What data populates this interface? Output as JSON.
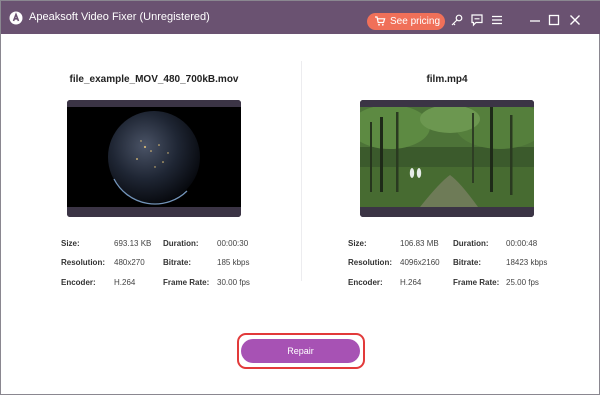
{
  "window": {
    "title": "Apeaksoft Video Fixer (Unregistered)",
    "pricing_label": "See pricing",
    "icons": [
      "key-icon",
      "feedback-icon",
      "menu-icon",
      "minimize-icon",
      "maximize-icon",
      "close-icon"
    ]
  },
  "colors": {
    "titlebar": "#6a5271",
    "pricing_button": "#f07059",
    "repair_button": "#a752b4",
    "highlight_outline": "#e23a3a"
  },
  "left_video": {
    "file_name": "file_example_MOV_480_700kB.mov",
    "thumbnail": "earth-at-night",
    "labels": {
      "size": "Size:",
      "duration": "Duration:",
      "resolution": "Resolution:",
      "bitrate": "Bitrate:",
      "encoder": "Encoder:",
      "frame_rate": "Frame Rate:"
    },
    "size": "693.13 KB",
    "duration": "00:00:30",
    "resolution": "480x270",
    "bitrate": "185 kbps",
    "encoder": "H.264",
    "frame_rate": "30.00 fps"
  },
  "right_video": {
    "file_name": "film.mp4",
    "thumbnail": "forest-path",
    "labels": {
      "size": "Size:",
      "duration": "Duration:",
      "resolution": "Resolution:",
      "bitrate": "Bitrate:",
      "encoder": "Encoder:",
      "frame_rate": "Frame Rate:"
    },
    "size": "106.83 MB",
    "duration": "00:00:48",
    "resolution": "4096x2160",
    "bitrate": "18423 kbps",
    "encoder": "H.264",
    "frame_rate": "25.00 fps"
  },
  "repair_label": "Repair"
}
